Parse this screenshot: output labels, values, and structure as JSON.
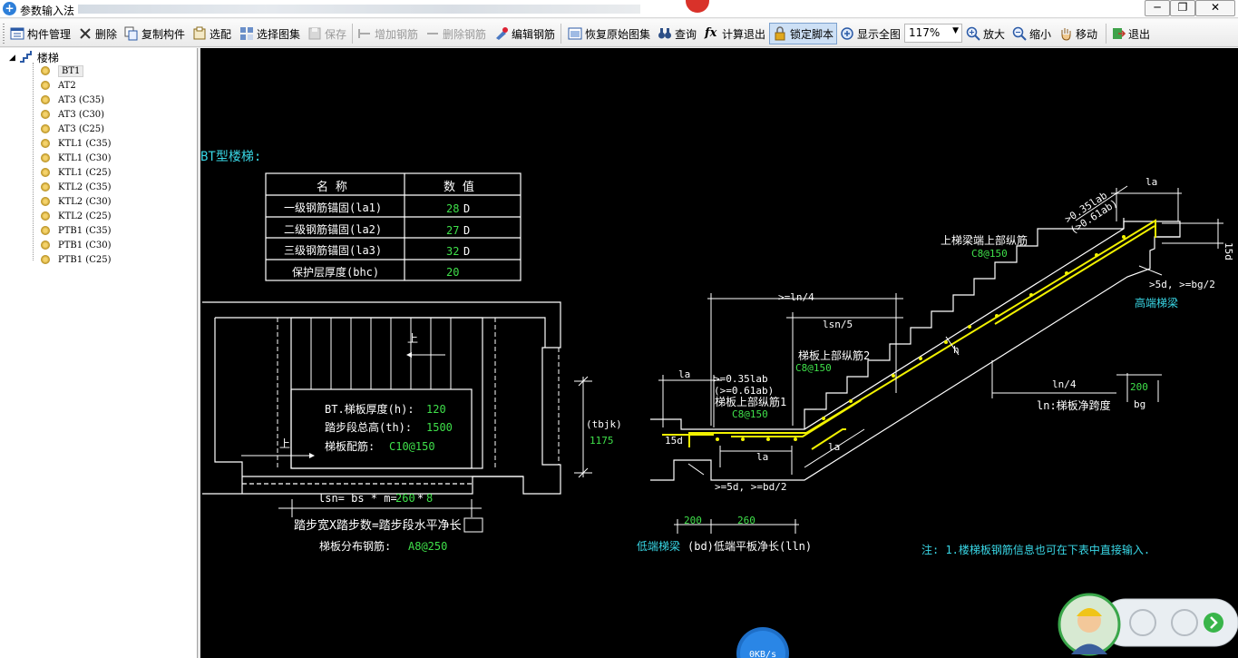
{
  "window": {
    "title": "参数输入法",
    "buttons": [
      "─",
      "❐",
      "✕"
    ]
  },
  "toolbar": {
    "items": [
      {
        "label": "构件管理",
        "icon": "component-manage-icon"
      },
      {
        "label": "删除",
        "icon": "delete-icon"
      },
      {
        "label": "复制构件",
        "icon": "copy-component-icon"
      },
      {
        "label": "选配",
        "icon": "select-config-icon"
      },
      {
        "label": "选择图集",
        "icon": "select-atlas-icon"
      },
      {
        "label": "保存",
        "icon": "save-icon",
        "disabled": true
      },
      {
        "label": "增加钢筋",
        "icon": "add-rebar-icon",
        "disabled": true
      },
      {
        "label": "删除钢筋",
        "icon": "delete-rebar-icon",
        "disabled": true
      },
      {
        "label": "编辑钢筋",
        "icon": "edit-rebar-icon"
      },
      {
        "label": "恢复原始图集",
        "icon": "restore-atlas-icon"
      },
      {
        "label": "查询",
        "icon": "binoculars-icon"
      },
      {
        "label": "计算退出",
        "icon": "function-icon"
      },
      {
        "label": "锁定脚本",
        "icon": "lock-icon",
        "pressed": true
      },
      {
        "label": "显示全图",
        "icon": "zoom-fit-icon"
      },
      {
        "label": "放大",
        "icon": "zoom-in-icon"
      },
      {
        "label": "缩小",
        "icon": "zoom-out-icon"
      },
      {
        "label": "移动",
        "icon": "hand-move-icon"
      },
      {
        "label": "退出",
        "icon": "exit-icon"
      }
    ],
    "zoom_value": "117%"
  },
  "tree": {
    "root": "楼梯",
    "items": [
      "BT1",
      "AT2",
      "AT3 (C35)",
      "AT3 (C30)",
      "AT3 (C25)",
      "KTL1 (C35)",
      "KTL1 (C30)",
      "KTL1 (C25)",
      "KTL2 (C35)",
      "KTL2 (C30)",
      "KTL2 (C25)",
      "PTB1 (C35)",
      "PTB1 (C30)",
      "PTB1 (C25)"
    ],
    "selected": "BT1"
  },
  "drawing": {
    "heading": "BT型楼梯:",
    "table": {
      "col_name": "名  称",
      "col_value": "数  值",
      "rows": [
        {
          "name": "一级钢筋锚固(la1)",
          "value": "28",
          "unit": "D"
        },
        {
          "name": "二级钢筋锚固(la2)",
          "value": "27",
          "unit": "D"
        },
        {
          "name": "三级钢筋锚固(la3)",
          "value": "32",
          "unit": "D"
        },
        {
          "name": "保护层厚度(bhc)",
          "value": "20",
          "unit": ""
        }
      ]
    },
    "plan": {
      "thickness_label": "BT.梯板厚度(h):",
      "thickness_value": "120",
      "height_label": "踏步段总高(th):",
      "height_value": "1500",
      "rebar_label": "梯板配筋:",
      "rebar_value": "C10@150",
      "up_label": "上",
      "tbjk_label": "(tbjk)",
      "tbjk_value": "1175",
      "lsn_formula": "lsn= bs * m=",
      "lsn_bs": "260",
      "lsn_star": "*",
      "lsn_m": "8",
      "lsn_caption": "踏步宽X踏步数=踏步段水平净长",
      "dist_label": "梯板分布钢筋:",
      "dist_value": "A8@250"
    },
    "section": {
      "top_la": "la",
      "top_035": ">0.35lab",
      "top_061": "(>0.61ab)",
      "top_15d": "15d",
      "top_beam_label": "上梯梁端上部纵筋",
      "top_beam_rebar": "C8@150",
      "top_5d": ">5d, >=bg/2",
      "high_beam": "高端梯梁",
      "ln4_top": ">=ln/4",
      "lsn5": "lsn/5",
      "upper2_label": "梯板上部纵筋2",
      "upper2_rebar": "C8@150",
      "h": "h",
      "ln4": "ln/4",
      "bg_value": "200",
      "ln_label": "ln:梯板净跨度",
      "bg": "bg",
      "left_la": "la",
      "left_035": ">=0.35lab",
      "left_061": "(>=0.61ab)",
      "upper1_label": "梯板上部纵筋1",
      "upper1_rebar": "C8@150",
      "left_15d": "15d",
      "la_low1": "la",
      "la_low2": "la",
      "low_5d": ">=5d, >=bd/2",
      "bd_value": "200",
      "lln_value": "260",
      "low_beam": "低端梯梁",
      "bd_lbl": "(bd)",
      "lln_label": "低端平板净长(lln)",
      "note": "注: 1.楼梯板钢筋信息也可在下表中直接输入."
    },
    "speed_badge": "0KB/s"
  },
  "colors": {
    "cad_bg": "#000000",
    "cad_white": "#ffffff",
    "cad_cyan": "#39d7e6",
    "cad_green": "#3fe04a",
    "cad_yellow": "#f2f200"
  }
}
